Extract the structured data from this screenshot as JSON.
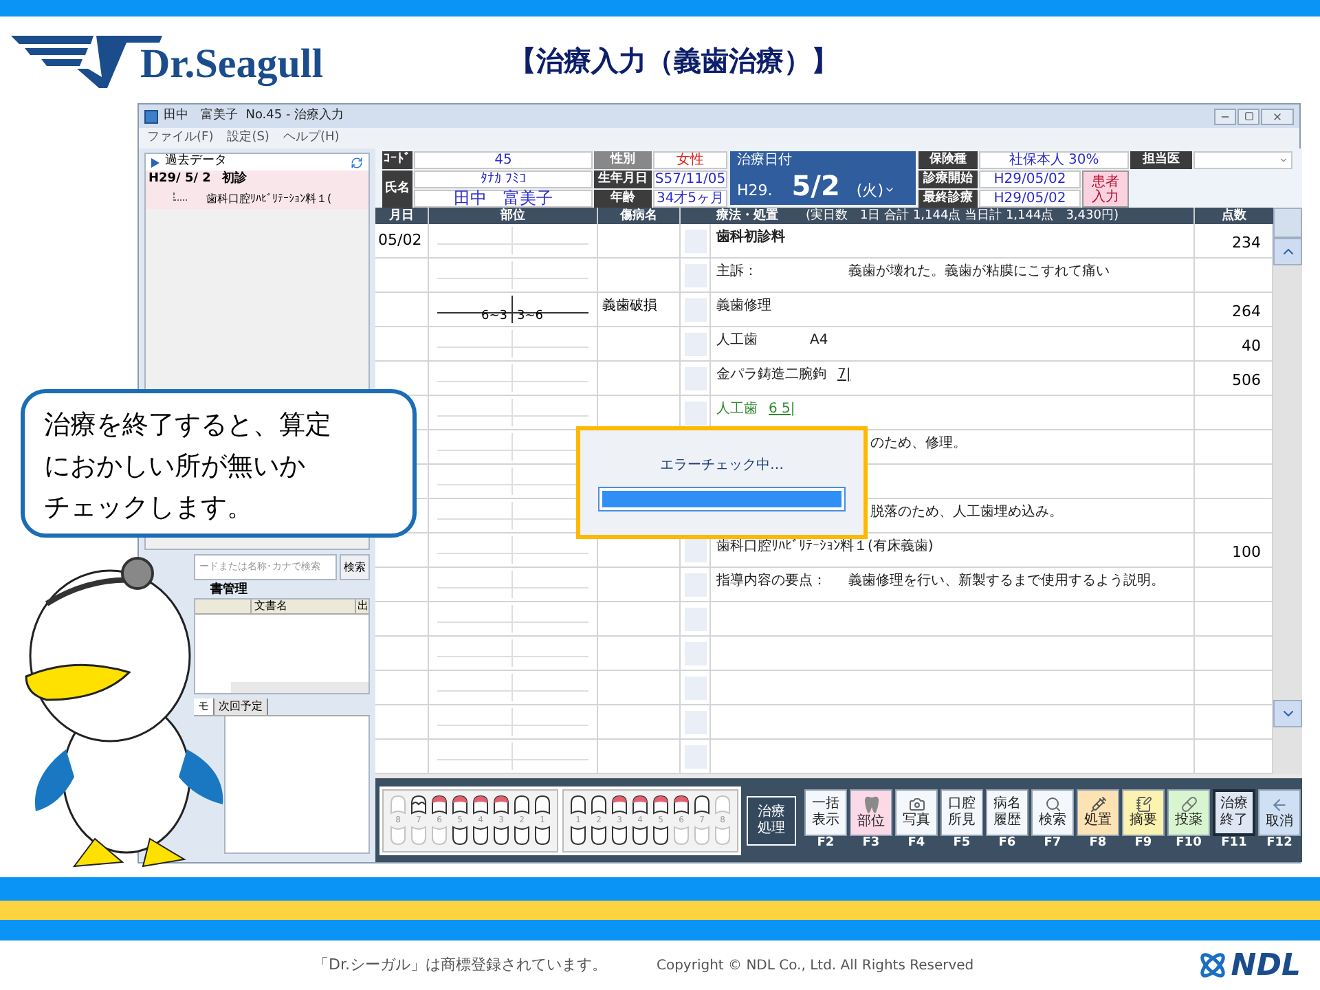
{
  "slide": {
    "logo": "Dr.Seagull",
    "title": "【治療入力（義歯治療）】",
    "callout": [
      "治療を終了すると、算定",
      "におかしい所が無いか",
      "チェックします。"
    ]
  },
  "window": {
    "title": "田中　富美子  No.45 - 治療入力",
    "menu": [
      "ファイル(F)",
      "設定(S)",
      "ヘルプ(H)"
    ]
  },
  "left_panel": {
    "tree": {
      "label": "過去データ",
      "visits": [
        {
          "date": "H29/ 5/ 2",
          "label": "初診",
          "selected": true,
          "children": [
            {
              "label": "歯科口腔ﾘﾊﾋﾞﾘﾃｰｼｮﾝ料１("
            }
          ]
        }
      ]
    },
    "search": {
      "placeholder": "ードまたは名称･カナで検索",
      "button": "検索"
    },
    "documents": {
      "title": "書管理",
      "columns": [
        "文書名",
        "出"
      ]
    },
    "tabs": [
      {
        "label": "モ",
        "selected": true
      },
      {
        "label": "次回予定",
        "selected": false
      }
    ]
  },
  "patient": {
    "code_label": "ｺｰﾄﾞ",
    "code": "45",
    "sex_label": "性別",
    "sex": "女性",
    "name_label": "氏名",
    "kana": "ﾀﾅｶ ﾌﾐｺ",
    "name": "田中　富美子",
    "birth_label": "生年月日",
    "birth": "S57/11/05",
    "age_label": "年齢",
    "age": "34才5ヶ月"
  },
  "treatment_date": {
    "label": "治療日付",
    "era": "H29.",
    "date": "5/2",
    "weekday": "(火)"
  },
  "insurance": {
    "type_label": "保険種",
    "type": "社保本人 30%",
    "doctor_label": "担当医",
    "start_label": "診療開始",
    "start": "H29/05/02",
    "last_label": "最終診療",
    "last": "H29/05/02",
    "patient_button": "患者入力"
  },
  "table": {
    "columns": [
      "月日",
      "部位",
      "傷病名",
      "療法・処置",
      "点数"
    ],
    "summary": "(実日数　1日 合計 1,144点 当日計 1,144点　3,430円)",
    "rows": [
      {
        "kind": "fee",
        "date": "05/02",
        "treatment": "歯科初診料",
        "points": "234"
      },
      {
        "kind": "note",
        "treatment": "主訴：",
        "detail": "義歯が壊れた。義歯が粘膜にこすれて痛い"
      },
      {
        "kind": "plain",
        "site_left": "6~3",
        "site_right": "3~6",
        "disease": "義歯破損",
        "treatment": "義歯修理",
        "points": "264"
      },
      {
        "kind": "plain",
        "treatment": "人工歯",
        "material": "A4",
        "points": "40"
      },
      {
        "kind": "plain",
        "treatment": "金パラ鋳造二腕鉤",
        "tooth": "7|",
        "points": "506"
      },
      {
        "kind": "pending",
        "treatment": "人工歯",
        "tooth": "6 5|"
      },
      {
        "kind": "covered",
        "treatment": "のため、修理。"
      },
      {
        "kind": "plain"
      },
      {
        "kind": "covered",
        "treatment": "脱落のため、人工歯埋め込み。"
      },
      {
        "kind": "plain",
        "treatment": "歯科口腔ﾘﾊﾋﾞﾘﾃｰｼｮﾝ料１(有床義歯)",
        "points": "100"
      },
      {
        "kind": "note",
        "treatment": "指導内容の要点：",
        "detail": "義歯修理を行い、新製するまで使用するよう説明。"
      }
    ]
  },
  "toolbar": {
    "teeth": [
      {
        "numbers": [
          "8",
          "7",
          "6",
          "5",
          "4",
          "3",
          "2",
          "1"
        ],
        "upper": [
          {
            "kind": "faded"
          },
          {
            "kind": "clasp"
          },
          {
            "kind": "marked"
          },
          {
            "kind": "marked"
          },
          {
            "kind": "marked"
          },
          {
            "kind": "marked"
          },
          {
            "kind": "normal"
          },
          {
            "kind": "normal"
          }
        ],
        "lower": [
          {
            "kind": "faded"
          },
          {
            "kind": "faded"
          },
          {
            "kind": "faded"
          },
          {
            "kind": "normal"
          },
          {
            "kind": "normal"
          },
          {
            "kind": "normal"
          },
          {
            "kind": "normal"
          },
          {
            "kind": "normal"
          }
        ]
      },
      {
        "numbers": [
          "1",
          "2",
          "3",
          "4",
          "5",
          "6",
          "7",
          "8"
        ],
        "upper": [
          {
            "kind": "normal"
          },
          {
            "kind": "normal"
          },
          {
            "kind": "marked"
          },
          {
            "kind": "marked"
          },
          {
            "kind": "marked"
          },
          {
            "kind": "marked"
          },
          {
            "kind": "normal"
          },
          {
            "kind": "faded"
          }
        ],
        "lower": [
          {
            "kind": "normal"
          },
          {
            "kind": "normal"
          },
          {
            "kind": "normal"
          },
          {
            "kind": "normal"
          },
          {
            "kind": "normal"
          },
          {
            "kind": "faded"
          },
          {
            "kind": "faded"
          },
          {
            "kind": "faded"
          }
        ]
      }
    ],
    "process_button": "治療処理",
    "function_keys": [
      {
        "label": "一括表示",
        "key": "F2",
        "kind": "text",
        "color": "#f4f7fb",
        "selected": false
      },
      {
        "label": "部位",
        "key": "F3",
        "kind": "tooth",
        "color": "#fcd9e6",
        "selected": false
      },
      {
        "label": "写真",
        "key": "F4",
        "kind": "camera",
        "color": "#f4f7fb",
        "selected": false
      },
      {
        "label": "口腔所見",
        "key": "F5",
        "kind": "text",
        "color": "#f4f7fb",
        "selected": false
      },
      {
        "label": "病名履歴",
        "key": "F6",
        "kind": "text",
        "color": "#f4f7fb",
        "selected": false
      },
      {
        "label": "検索",
        "key": "F7",
        "kind": "search",
        "color": "#f4f7fb",
        "selected": false
      },
      {
        "label": "処置",
        "key": "F8",
        "kind": "probe",
        "color": "#fde3b3",
        "selected": false
      },
      {
        "label": "摘要",
        "key": "F9",
        "kind": "note",
        "color": "#fdf3b0",
        "selected": false
      },
      {
        "label": "投薬",
        "key": "F10",
        "kind": "pill",
        "color": "#d8f5d0",
        "selected": false
      },
      {
        "label": "治療終了",
        "key": "F11",
        "kind": "text",
        "color": "#dde6f2",
        "selected": true
      },
      {
        "label": "取消",
        "key": "F12",
        "kind": "back",
        "color": "#cfe0f5",
        "selected": false
      }
    ]
  },
  "dialog": {
    "message": "エラーチェック中…",
    "level": 1
  },
  "footer": {
    "trademark": "「Dr.シーガル」は商標登録されています。",
    "copyright": "Copyright © NDL Co., Ltd. All Rights Reserved",
    "brand": "NDL"
  }
}
